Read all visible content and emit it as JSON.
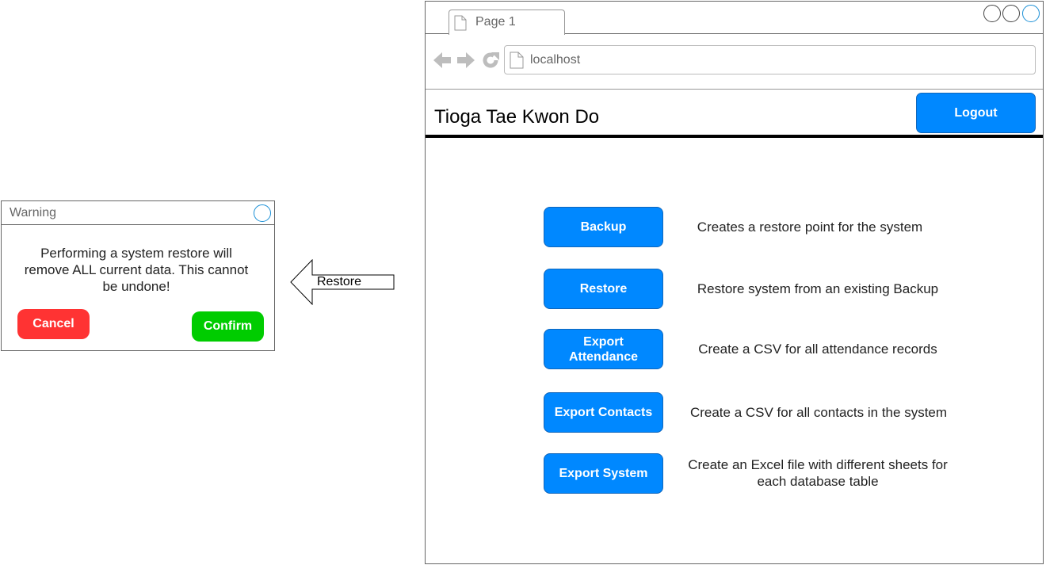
{
  "dialog": {
    "title": "Warning",
    "message": "Performing a system restore will remove ALL current data. This cannot be undone!",
    "cancel_label": "Cancel",
    "confirm_label": "Confirm"
  },
  "arrow": {
    "label": "Restore"
  },
  "browser": {
    "tab_title": "Page 1",
    "url": "localhost"
  },
  "app": {
    "title": "Tioga Tae Kwon Do",
    "logout_label": "Logout"
  },
  "actions": [
    {
      "label": "Backup",
      "description": "Creates a restore point for the system"
    },
    {
      "label": "Restore",
      "description": "Restore system from an existing Backup"
    },
    {
      "label": "Export Attendance",
      "description": "Create a CSV for all attendance records"
    },
    {
      "label": "Export Contacts",
      "description": "Create a CSV for all contacts in the system"
    },
    {
      "label": "Export System",
      "description": "Create an Excel file with different sheets for each database table"
    }
  ],
  "colors": {
    "primary_button": "#0088ff",
    "cancel_button": "#ff3333",
    "confirm_button": "#00cc00",
    "close_circle": "#1a8fd6"
  },
  "icons": {
    "tab": "page-icon",
    "back": "arrow-left-icon",
    "forward": "arrow-right-icon",
    "reload": "reload-icon",
    "url": "page-icon",
    "close": "circle-close-icon"
  }
}
